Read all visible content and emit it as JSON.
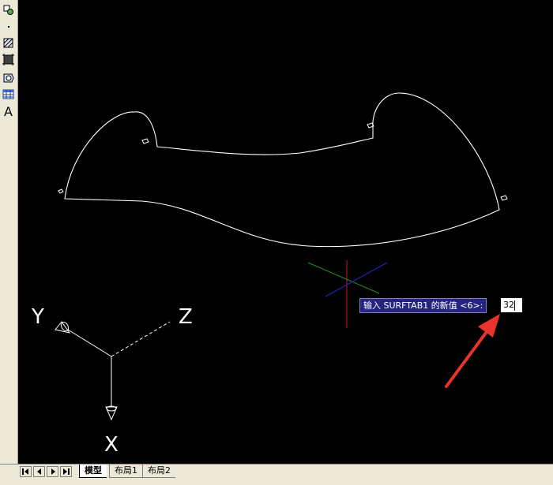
{
  "toolbar": {
    "tools": [
      {
        "icon": "insert-block-icon"
      },
      {
        "icon": "point-icon"
      },
      {
        "icon": "hatch-icon"
      },
      {
        "icon": "gradient-icon"
      },
      {
        "icon": "region-icon"
      },
      {
        "icon": "table-icon"
      },
      {
        "icon": "multiline-text-icon",
        "label": "A"
      }
    ]
  },
  "command": {
    "prompt": "输入 SURFTAB1 的新值 <6>:",
    "value": "32"
  },
  "ucs": {
    "x_label": "X",
    "y_label": "Y",
    "z_label": "Z"
  },
  "tabs": {
    "items": [
      "模型",
      "布局1",
      "布局2"
    ],
    "active": "模型"
  },
  "colors": {
    "drawing": "#ffffff",
    "background": "#000000",
    "crosshair_red": "#c81e1e",
    "crosshair_green": "#1e8c1e",
    "crosshair_blue": "#1e1e96",
    "arrow": "#e8342a",
    "prompt_bg": "#252580"
  }
}
